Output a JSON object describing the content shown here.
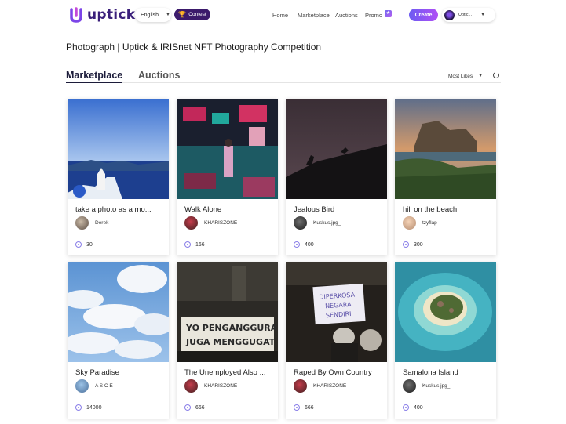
{
  "header": {
    "logo_text": "uptick",
    "language": "English",
    "contest_label": "Contest",
    "nav": [
      "Home",
      "Marketplace",
      "Auctions",
      "Promo"
    ],
    "create_label": "Create",
    "user_label": "Uptic..."
  },
  "page": {
    "title": "Photograph | Uptick & IRISnet NFT Photography Competition",
    "tabs": [
      "Marketplace",
      "Auctions"
    ],
    "sort_label": "Most Likes"
  },
  "cards": [
    {
      "title": "take a photo as a mo...",
      "owner": "Derek",
      "likes": "30"
    },
    {
      "title": "Walk Alone",
      "owner": "KHARISZONE",
      "likes": "166"
    },
    {
      "title": "Jealous Bird",
      "owner": "Kuskus.jpg_",
      "likes": "400"
    },
    {
      "title": "hill on the beach",
      "owner": "tzyflap",
      "likes": "300"
    },
    {
      "title": "Sky Paradise",
      "owner": "A S C E",
      "likes": "14000"
    },
    {
      "title": "The Unemployed Also ...",
      "owner": "KHARISZONE",
      "likes": "666"
    },
    {
      "title": "Raped By Own Country",
      "owner": "KHARISZONE",
      "likes": "666"
    },
    {
      "title": "Samalona Island",
      "owner": "Kuskus.jpg_",
      "likes": "400"
    }
  ],
  "image_text": {
    "banner_line1": "YO PENGANGGURAN",
    "banner_line2": "JUGA MENGGUGAT",
    "sign_line1": "DIPERKOSA",
    "sign_line2": "NEGARA",
    "sign_line3": "SENDIRI"
  },
  "colors": {
    "brand_dark": "#3a1f7a",
    "create_gradient_start": "#6d5cf2",
    "create_gradient_end": "#b04ff5",
    "like_icon": "#8a7fe8"
  },
  "icons": {
    "like": "like-icon",
    "refresh": "refresh-icon",
    "trophy": "trophy-icon",
    "caret": "chevron-down-icon"
  }
}
